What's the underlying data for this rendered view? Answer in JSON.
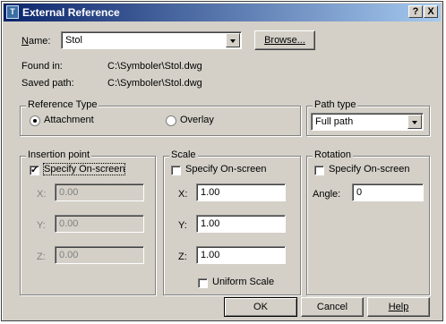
{
  "window": {
    "title": "External Reference",
    "icon_name": "autocad-app-icon",
    "help_label": "?",
    "close_label": "X"
  },
  "name_row": {
    "label": "Name:",
    "value": "Stol",
    "browse_label": "Browse..."
  },
  "info": {
    "found_in_label": "Found in:",
    "found_in_value": "C:\\Symboler\\Stol.dwg",
    "saved_path_label": "Saved path:",
    "saved_path_value": "C:\\Symboler\\Stol.dwg"
  },
  "reference_type": {
    "legend": "Reference Type",
    "attachment_label": "Attachment",
    "overlay_label": "Overlay",
    "selected": "Attachment"
  },
  "path_type": {
    "legend": "Path type",
    "value": "Full path"
  },
  "insertion_point": {
    "legend": "Insertion point",
    "specify_label": "Specify On-screen",
    "specify_checked": true,
    "x_label": "X:",
    "x_value": "0.00",
    "y_label": "Y:",
    "y_value": "0.00",
    "z_label": "Z:",
    "z_value": "0.00"
  },
  "scale": {
    "legend": "Scale",
    "specify_label": "Specify On-screen",
    "specify_checked": false,
    "x_label": "X:",
    "x_value": "1.00",
    "y_label": "Y:",
    "y_value": "1.00",
    "z_label": "Z:",
    "z_value": "1.00",
    "uniform_label": "Uniform Scale",
    "uniform_checked": false
  },
  "rotation": {
    "legend": "Rotation",
    "specify_label": "Specify On-screen",
    "specify_checked": false,
    "angle_label": "Angle:",
    "angle_value": "0"
  },
  "buttons": {
    "ok": "OK",
    "cancel": "Cancel",
    "help": "Help"
  },
  "colors": {
    "title_start": "#0a246a",
    "title_end": "#a6caf0",
    "face": "#d4d0c8"
  }
}
